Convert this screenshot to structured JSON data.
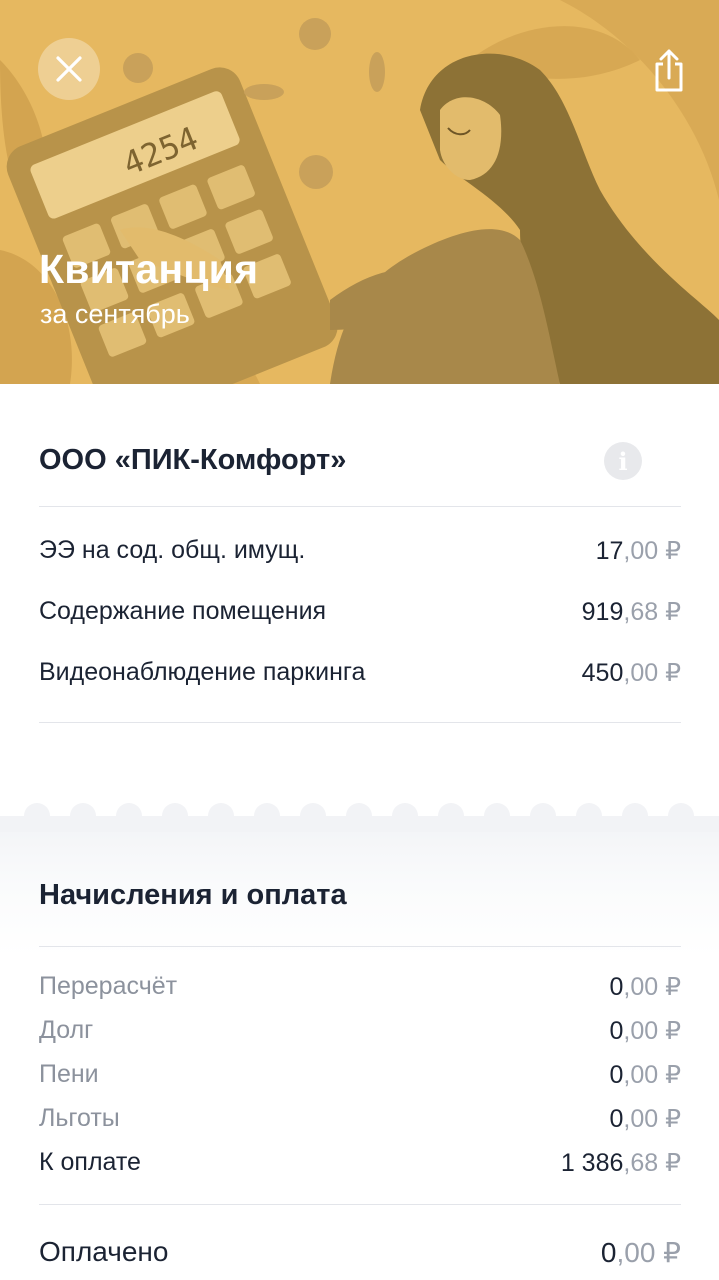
{
  "header": {
    "title": "Квитанция",
    "subtitle": "за сентябрь",
    "calculator_display": "4254",
    "background_color": "#e6b860"
  },
  "icons": {
    "close": "close-icon",
    "share": "share-icon",
    "info": "info-icon"
  },
  "provider": {
    "name": "ООО «ПИК-Комфорт»",
    "info_glyph": "i",
    "services": [
      {
        "label": "ЭЭ на сод. общ. имущ.",
        "int": "17",
        "frac": ",00",
        "currency": " ₽"
      },
      {
        "label": "Содержание помещения",
        "int": "919",
        "frac": ",68",
        "currency": " ₽"
      },
      {
        "label": "Видеонаблюдение паркинга",
        "int": "450",
        "frac": ",00",
        "currency": " ₽"
      }
    ]
  },
  "charges": {
    "title": "Начисления и оплата",
    "items": [
      {
        "label": "Перерасчёт",
        "int": "0",
        "frac": ",00",
        "currency": " ₽"
      },
      {
        "label": "Долг",
        "int": "0",
        "frac": ",00",
        "currency": " ₽"
      },
      {
        "label": "Пени",
        "int": "0",
        "frac": ",00",
        "currency": " ₽"
      },
      {
        "label": "Льготы",
        "int": "0",
        "frac": ",00",
        "currency": " ₽"
      },
      {
        "label": "К оплате",
        "int": "1 386",
        "frac": ",68",
        "currency": " ₽"
      }
    ],
    "paid": {
      "label": "Оплачено",
      "int": "0",
      "frac": ",00",
      "currency": " ₽"
    }
  }
}
